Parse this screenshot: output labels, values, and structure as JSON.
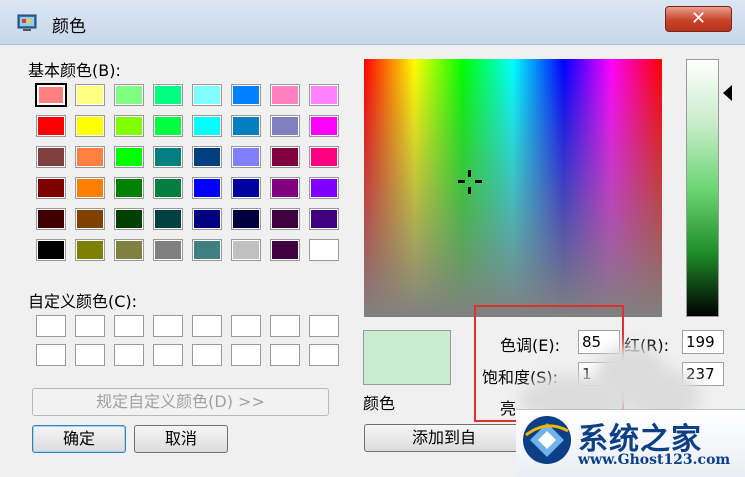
{
  "window": {
    "title": "颜色",
    "close_label": "✕"
  },
  "basic_colors": {
    "label": "基本颜色(B):",
    "rows": [
      [
        "#ff8080",
        "#ffff80",
        "#80ff80",
        "#00ff80",
        "#80ffff",
        "#0080ff",
        "#ff80c0",
        "#ff80ff"
      ],
      [
        "#ff0000",
        "#ffff00",
        "#80ff00",
        "#00ff40",
        "#00ffff",
        "#0080c0",
        "#8080c0",
        "#ff00ff"
      ],
      [
        "#804040",
        "#ff8040",
        "#00ff00",
        "#008080",
        "#004080",
        "#8080ff",
        "#800040",
        "#ff0080"
      ],
      [
        "#800000",
        "#ff8000",
        "#008000",
        "#008040",
        "#0000ff",
        "#0000a0",
        "#800080",
        "#8000ff"
      ],
      [
        "#400000",
        "#804000",
        "#004000",
        "#004040",
        "#000080",
        "#000040",
        "#400040",
        "#400080"
      ],
      [
        "#000000",
        "#808000",
        "#808040",
        "#808080",
        "#408080",
        "#c0c0c0",
        "#400040",
        "#ffffff"
      ]
    ],
    "selected_color": "#ff8080"
  },
  "custom_colors": {
    "label": "自定义颜色(C):",
    "slot_count": 16
  },
  "buttons": {
    "define_custom": "规定自定义颜色(D) >>",
    "ok": "确定",
    "cancel": "取消",
    "add_to_custom": "添加到自"
  },
  "preview": {
    "label": "颜色",
    "color": "#c8ecd0"
  },
  "fields": {
    "hue": {
      "label": "色调(E):",
      "value": "85"
    },
    "saturation": {
      "label": "饱和度(S):",
      "value": "1"
    },
    "luminance": {
      "label": "亮",
      "value": ""
    },
    "red": {
      "label": "红(R):",
      "value": "199"
    },
    "green": {
      "value": "237"
    }
  },
  "watermark": {
    "title": "系统之家",
    "url": "www.Ghost123.com"
  },
  "colors": {
    "highlight_box": "#e0302c",
    "watermark_blue": "#0c3f86"
  }
}
